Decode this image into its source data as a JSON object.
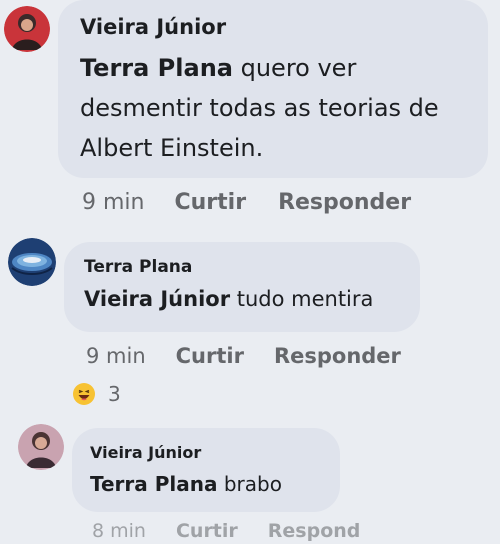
{
  "comments": [
    {
      "author": "Vieira Júnior",
      "mention": "Terra Plana",
      "text": " quero ver desmentir todas as teorias de Albert Einstein.",
      "time": "9 min",
      "like_label": "Curtir",
      "reply_label": "Responder",
      "avatar_icon": "profile-photo-icon"
    },
    {
      "author": "Terra Plana",
      "mention": "Vieira Júnior",
      "text": " tudo mentira",
      "time": "9 min",
      "like_label": "Curtir",
      "reply_label": "Responder",
      "reaction_icon": "haha-emoji-icon",
      "reaction_count": "3",
      "avatar_icon": "globe-icon"
    },
    {
      "author": "Vieira Júnior",
      "mention": "Terra Plana",
      "text": " brabo",
      "time": "8 min",
      "like_label": "Curtir",
      "reply_label": "Respond",
      "avatar_icon": "profile-photo-icon"
    }
  ],
  "colors": {
    "background": "#eaedf2",
    "bubble": "#dfe3ec",
    "secondary_text": "#65676b"
  }
}
